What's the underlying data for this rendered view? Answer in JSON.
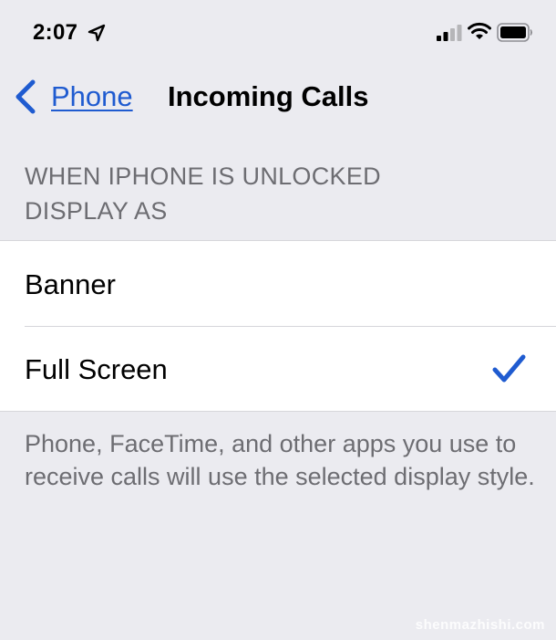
{
  "status_bar": {
    "time": "2:07",
    "location_icon": "location-arrow-icon",
    "signal_icon": "cellular-signal-icon",
    "wifi_icon": "wifi-icon",
    "battery_icon": "battery-icon"
  },
  "nav": {
    "back_label": "Phone",
    "title": "Incoming Calls"
  },
  "section": {
    "header_line1": "WHEN IPHONE IS UNLOCKED",
    "header_line2": "DISPLAY AS"
  },
  "options": [
    {
      "label": "Banner",
      "selected": false
    },
    {
      "label": "Full Screen",
      "selected": true
    }
  ],
  "footer": {
    "text": "Phone, FaceTime, and other apps you use to receive calls will use the selected display style."
  },
  "watermark": "shenmazhishi.com",
  "colors": {
    "accent": "#1f5bd0",
    "background": "#ebebf0",
    "secondary_text": "#6d6d72"
  }
}
